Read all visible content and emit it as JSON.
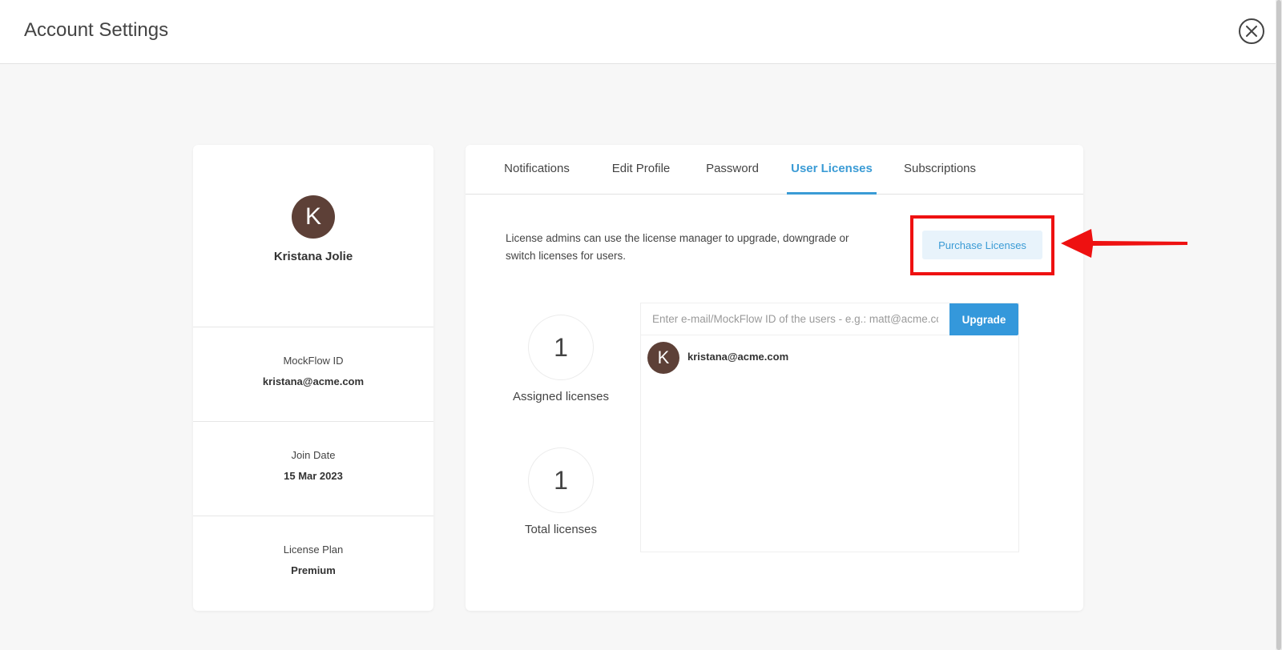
{
  "header": {
    "title": "Account Settings",
    "close_icon": "close-circle-icon"
  },
  "profile": {
    "avatar_initial": "K",
    "name": "Kristana Jolie",
    "fields": [
      {
        "label": "MockFlow ID",
        "value": "kristana@acme.com"
      },
      {
        "label": "Join Date",
        "value": "15 Mar 2023"
      },
      {
        "label": "License Plan",
        "value": "Premium"
      }
    ]
  },
  "tabs": [
    {
      "label": "Notifications",
      "active": false
    },
    {
      "label": "Edit Profile",
      "active": false
    },
    {
      "label": "Password",
      "active": false
    },
    {
      "label": "User Licenses",
      "active": true
    },
    {
      "label": "Subscriptions",
      "active": false
    }
  ],
  "licenses": {
    "description": "License admins can use the license manager to upgrade, downgrade or switch licenses for users.",
    "purchase_label": "Purchase Licenses",
    "assigned": {
      "count": "1",
      "label": "Assigned licenses"
    },
    "total": {
      "count": "1",
      "label": "Total licenses"
    },
    "search_placeholder": "Enter e-mail/MockFlow ID of the users - e.g.: matt@acme.com",
    "upgrade_label": "Upgrade",
    "users": [
      {
        "initial": "K",
        "email": "kristana@acme.com"
      }
    ]
  },
  "colors": {
    "accent": "#3a9bd5",
    "highlight": "#ee1111",
    "avatar": "#5d4037"
  }
}
